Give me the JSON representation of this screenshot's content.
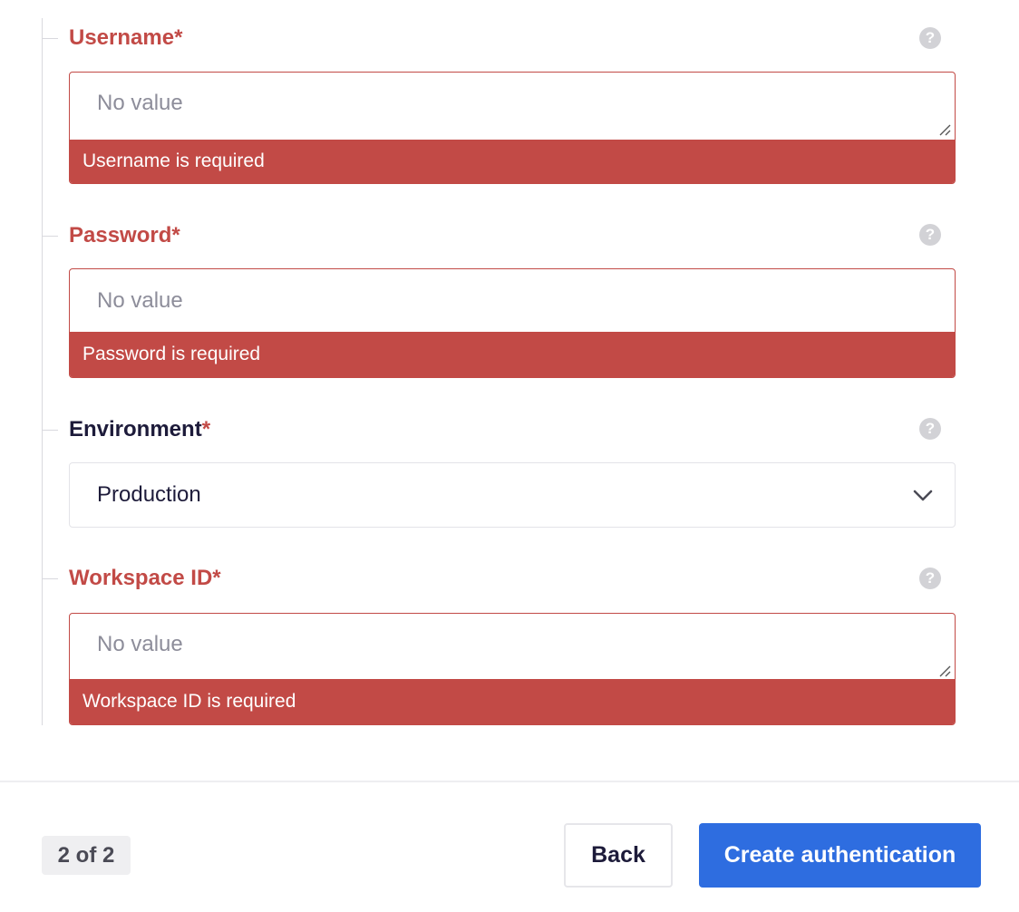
{
  "form": {
    "required_marker": "*",
    "help_glyph": "?",
    "fields": [
      {
        "label": "Username",
        "type": "textarea",
        "placeholder": "No value",
        "value": "",
        "error": "Username is required",
        "help_icon": "question-circle-icon"
      },
      {
        "label": "Password",
        "type": "password",
        "placeholder": "No value",
        "value": "",
        "error": "Password is required",
        "help_icon": "question-circle-icon"
      },
      {
        "label": "Environment",
        "type": "select",
        "selected": "Production",
        "help_icon": "question-circle-icon",
        "dropdown_icon": "chevron-down-icon"
      },
      {
        "label": "Workspace ID",
        "type": "textarea",
        "placeholder": "No value",
        "value": "",
        "error": "Workspace ID is required",
        "help_icon": "question-circle-icon"
      }
    ]
  },
  "footer": {
    "step_indicator": "2 of 2",
    "back_label": "Back",
    "create_label": "Create authentication"
  },
  "colors": {
    "error": "#c24a46",
    "primary": "#2e6de0",
    "label_text": "#1d1b3a",
    "placeholder_text": "#8d8d9a",
    "help_icon": "#d2d2d6"
  }
}
